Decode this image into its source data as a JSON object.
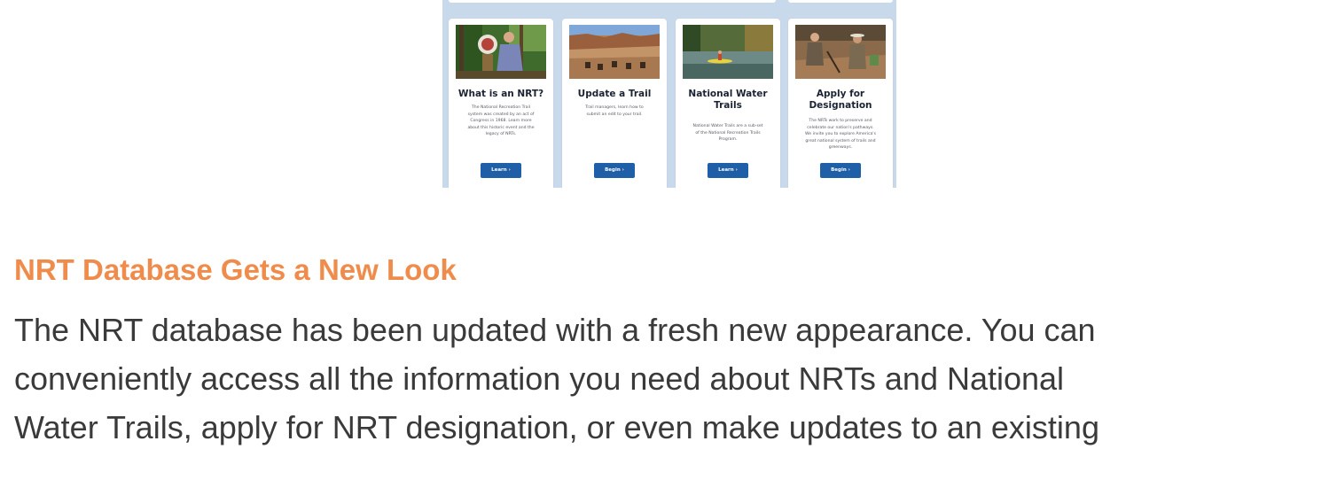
{
  "cards": [
    {
      "title_lines": [
        "What is an NRT?"
      ],
      "description_lines": [
        "The National Recreation Trail",
        "system was created by an act of",
        "Congress in 1968. Learn more",
        "about this historic event and the",
        "legacy of NRTs."
      ],
      "button_label": "Learn ›",
      "photo": "person-at-trail-sign-photo"
    },
    {
      "title_lines": [
        "Update a Trail"
      ],
      "description_lines": [
        "Trail managers, learn how to",
        "submit an edit to your trail."
      ],
      "button_label": "Begin ›",
      "photo": "canyon-mule-riders-photo"
    },
    {
      "title_lines": [
        "National Water",
        "Trails"
      ],
      "description_lines": [
        "National Water Trails are a sub-set",
        "of the National Recreation Trails",
        "Program."
      ],
      "button_label": "Learn ›",
      "photo": "kayak-on-river-photo"
    },
    {
      "title_lines": [
        "Apply for",
        "Designation"
      ],
      "description_lines": [
        "The NRTs work to preserve and",
        "celebrate our nation's pathways.",
        "We invite you to explore America's",
        "great national system of trails and",
        "greenways."
      ],
      "button_label": "Begin ›",
      "photo": "trail-workers-photo"
    }
  ],
  "article": {
    "title": "NRT Database Gets a New Look",
    "body_lines": [
      "The NRT database has been updated with a fresh new appearance. You can",
      "conveniently access all the information you need about NRTs and National",
      "Water Trails, apply for NRT designation, or even make updates to an existing"
    ]
  },
  "colors": {
    "accent_orange": "#f08c4b",
    "button_blue": "#1e5fa8",
    "panel_background": "#c9d9ec"
  }
}
